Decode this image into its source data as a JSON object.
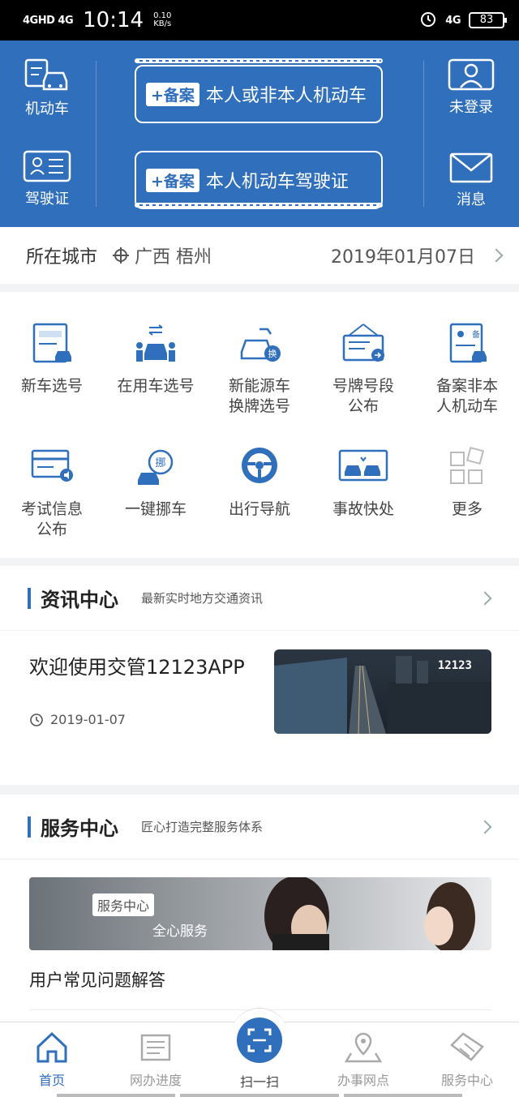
{
  "status_bar": {
    "network_left": "4GHD 4G",
    "time": "10:14",
    "speed_value": "0.10",
    "speed_unit": "KB/s",
    "network_right": "4G",
    "battery": "83"
  },
  "header": {
    "vehicle_label": "机动车",
    "license_label": "驾驶证",
    "login_label": "未登录",
    "message_label": "消息",
    "ticket1": {
      "tag": "+备案",
      "text": "本人或非本人机动车"
    },
    "ticket2": {
      "tag": "+备案",
      "text": "本人机动车驾驶证"
    }
  },
  "city": {
    "label": "所在城市",
    "location": "广西 梧州",
    "date": "2019年01月07日"
  },
  "grid": [
    {
      "line1": "新车选号",
      "line2": "",
      "icon": "new-car-plate-icon"
    },
    {
      "line1": "在用车选号",
      "line2": "",
      "icon": "used-car-plate-icon"
    },
    {
      "line1": "新能源车",
      "line2": "换牌选号",
      "icon": "ev-plate-icon"
    },
    {
      "line1": "号牌号段",
      "line2": "公布",
      "icon": "plate-range-icon"
    },
    {
      "line1": "备案非本",
      "line2": "人机动车",
      "icon": "register-vehicle-icon"
    },
    {
      "line1": "考试信息",
      "line2": "公布",
      "icon": "exam-info-icon"
    },
    {
      "line1": "一键挪车",
      "line2": "",
      "icon": "move-car-icon"
    },
    {
      "line1": "出行导航",
      "line2": "",
      "icon": "steering-wheel-icon"
    },
    {
      "line1": "事故快处",
      "line2": "",
      "icon": "accident-icon"
    },
    {
      "line1": "更多",
      "line2": "",
      "icon": "more-icon"
    }
  ],
  "news": {
    "title": "资讯中心",
    "subtitle": "最新实时地方交通资讯",
    "item_title": "欢迎使用交管12123APP",
    "item_date": "2019-01-07",
    "image_caption": "12123"
  },
  "service": {
    "title": "服务中心",
    "subtitle": "匠心打造完整服务体系",
    "banner_tag": "服务中心",
    "banner_tagline": "全心服务",
    "faq": "用户常见问题解答"
  },
  "bottom_nav": {
    "home": "首页",
    "progress": "网办进度",
    "scan": "扫一扫",
    "outlets": "办事网点",
    "service": "服务中心"
  },
  "colors": {
    "brand": "#2f6fbb"
  }
}
